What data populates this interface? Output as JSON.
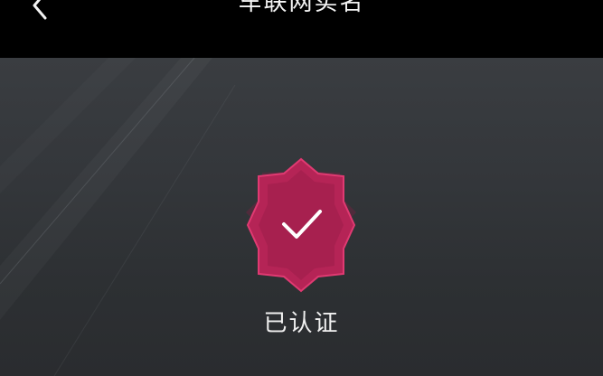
{
  "header": {
    "title": "车联网实名",
    "back_icon": "chevron-left-icon"
  },
  "main": {
    "badge_icon": "verified-badge-icon",
    "check_icon": "checkmark-icon",
    "badge_color": "#c2285a",
    "status_text": "已认证"
  }
}
